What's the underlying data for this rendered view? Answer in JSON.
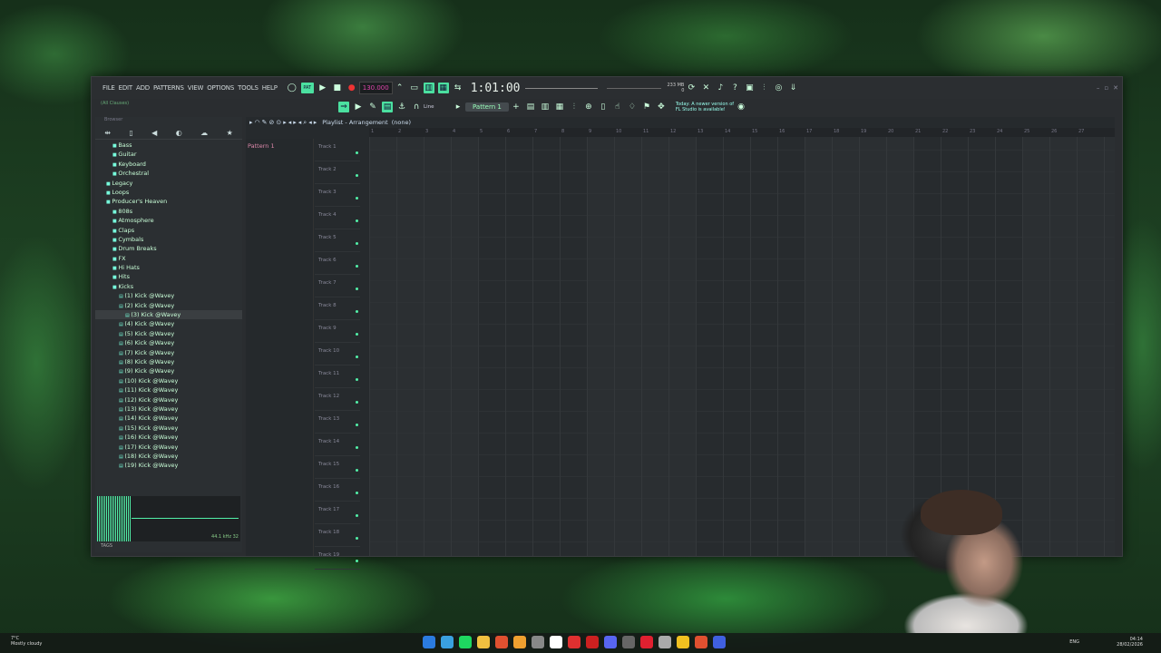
{
  "menu": [
    "FILE",
    "EDIT",
    "ADD",
    "PATTERNS",
    "VIEW",
    "OPTIONS",
    "TOOLS",
    "HELP"
  ],
  "hint_text": "(All Clauses)",
  "tempo": "130.000",
  "time": "1:01:00",
  "memory": "233 MB",
  "memory_sub": "0",
  "snap": "Line",
  "pattern_selector": "Pattern 1",
  "notice_line1": "Today: A newer version of",
  "notice_line2": "FL Studio is available!",
  "browser": {
    "title": "Browser",
    "items": [
      {
        "label": "Bass",
        "kind": "fold",
        "indent": 1
      },
      {
        "label": "Guitar",
        "kind": "fold",
        "indent": 1
      },
      {
        "label": "Keyboard",
        "kind": "fold",
        "indent": 1
      },
      {
        "label": "Orchestral",
        "kind": "fold",
        "indent": 1
      },
      {
        "label": "Legacy",
        "kind": "fold",
        "indent": 0
      },
      {
        "label": "Loops",
        "kind": "fold",
        "indent": 0
      },
      {
        "label": "Producer's Heaven",
        "kind": "fold",
        "indent": 0
      },
      {
        "label": "808s",
        "kind": "fold",
        "indent": 1
      },
      {
        "label": "Atmosphere",
        "kind": "fold",
        "indent": 1
      },
      {
        "label": "Claps",
        "kind": "fold",
        "indent": 1
      },
      {
        "label": "Cymbals",
        "kind": "fold",
        "indent": 1
      },
      {
        "label": "Drum Breaks",
        "kind": "fold",
        "indent": 1
      },
      {
        "label": "FX",
        "kind": "fold",
        "indent": 1
      },
      {
        "label": "Hi Hats",
        "kind": "fold",
        "indent": 1
      },
      {
        "label": "Hits",
        "kind": "fold",
        "indent": 1
      },
      {
        "label": "Kicks",
        "kind": "fold",
        "indent": 1
      },
      {
        "label": "(1) Kick @Wavey",
        "kind": "file",
        "indent": 2
      },
      {
        "label": "(2) Kick @Wavey",
        "kind": "file",
        "indent": 2
      },
      {
        "label": "(3) Kick @Wavey",
        "kind": "file",
        "indent": 3,
        "selected": true
      },
      {
        "label": "(4) Kick @Wavey",
        "kind": "file",
        "indent": 2
      },
      {
        "label": "(5) Kick @Wavey",
        "kind": "file",
        "indent": 2
      },
      {
        "label": "(6) Kick @Wavey",
        "kind": "file",
        "indent": 2
      },
      {
        "label": "(7) Kick @Wavey",
        "kind": "file",
        "indent": 2
      },
      {
        "label": "(8) Kick @Wavey",
        "kind": "file",
        "indent": 2
      },
      {
        "label": "(9) Kick @Wavey",
        "kind": "file",
        "indent": 2
      },
      {
        "label": "(10) Kick @Wavey",
        "kind": "file",
        "indent": 2
      },
      {
        "label": "(11) Kick @Wavey",
        "kind": "file",
        "indent": 2
      },
      {
        "label": "(12) Kick @Wavey",
        "kind": "file",
        "indent": 2
      },
      {
        "label": "(13) Kick @Wavey",
        "kind": "file",
        "indent": 2
      },
      {
        "label": "(14) Kick @Wavey",
        "kind": "file",
        "indent": 2
      },
      {
        "label": "(15) Kick @Wavey",
        "kind": "file",
        "indent": 2
      },
      {
        "label": "(16) Kick @Wavey",
        "kind": "file",
        "indent": 2
      },
      {
        "label": "(17) Kick @Wavey",
        "kind": "file",
        "indent": 2
      },
      {
        "label": "(18) Kick @Wavey",
        "kind": "file",
        "indent": 2
      },
      {
        "label": "(19) Kick @Wavey",
        "kind": "file",
        "indent": 2
      }
    ],
    "sample_rate": "44.1 kHz 32",
    "tags_label": "TAGS"
  },
  "playlist": {
    "title": "Playlist - Arrangement",
    "subtitle": "(none)",
    "pattern_item": "Pattern 1",
    "tracks": [
      "Track 1",
      "Track 2",
      "Track 3",
      "Track 4",
      "Track 5",
      "Track 6",
      "Track 7",
      "Track 8",
      "Track 9",
      "Track 10",
      "Track 11",
      "Track 12",
      "Track 13",
      "Track 14",
      "Track 15",
      "Track 16",
      "Track 17",
      "Track 18",
      "Track 19"
    ],
    "ruler": [
      "1",
      "2",
      "3",
      "4",
      "5",
      "6",
      "7",
      "8",
      "9",
      "10",
      "11",
      "12",
      "13",
      "14",
      "15",
      "16",
      "17",
      "18",
      "19",
      "20",
      "21",
      "22",
      "23",
      "24",
      "25",
      "26",
      "27"
    ]
  },
  "taskbar": {
    "weather_temp": "7°C",
    "weather_desc": "Mostly cloudy",
    "lang": "ENG",
    "time": "04:14",
    "date": "28/02/2026",
    "app_colors": [
      "#2b7be0",
      "#3aa0e0",
      "#1ed760",
      "#f0c040",
      "#e05030",
      "#f0a030",
      "#888888",
      "#ffffff",
      "#e03030",
      "#cc2020",
      "#5865f2",
      "#666666",
      "#e02030",
      "#aaaaaa",
      "#f0c020",
      "#e05030",
      "#4060e0"
    ]
  }
}
